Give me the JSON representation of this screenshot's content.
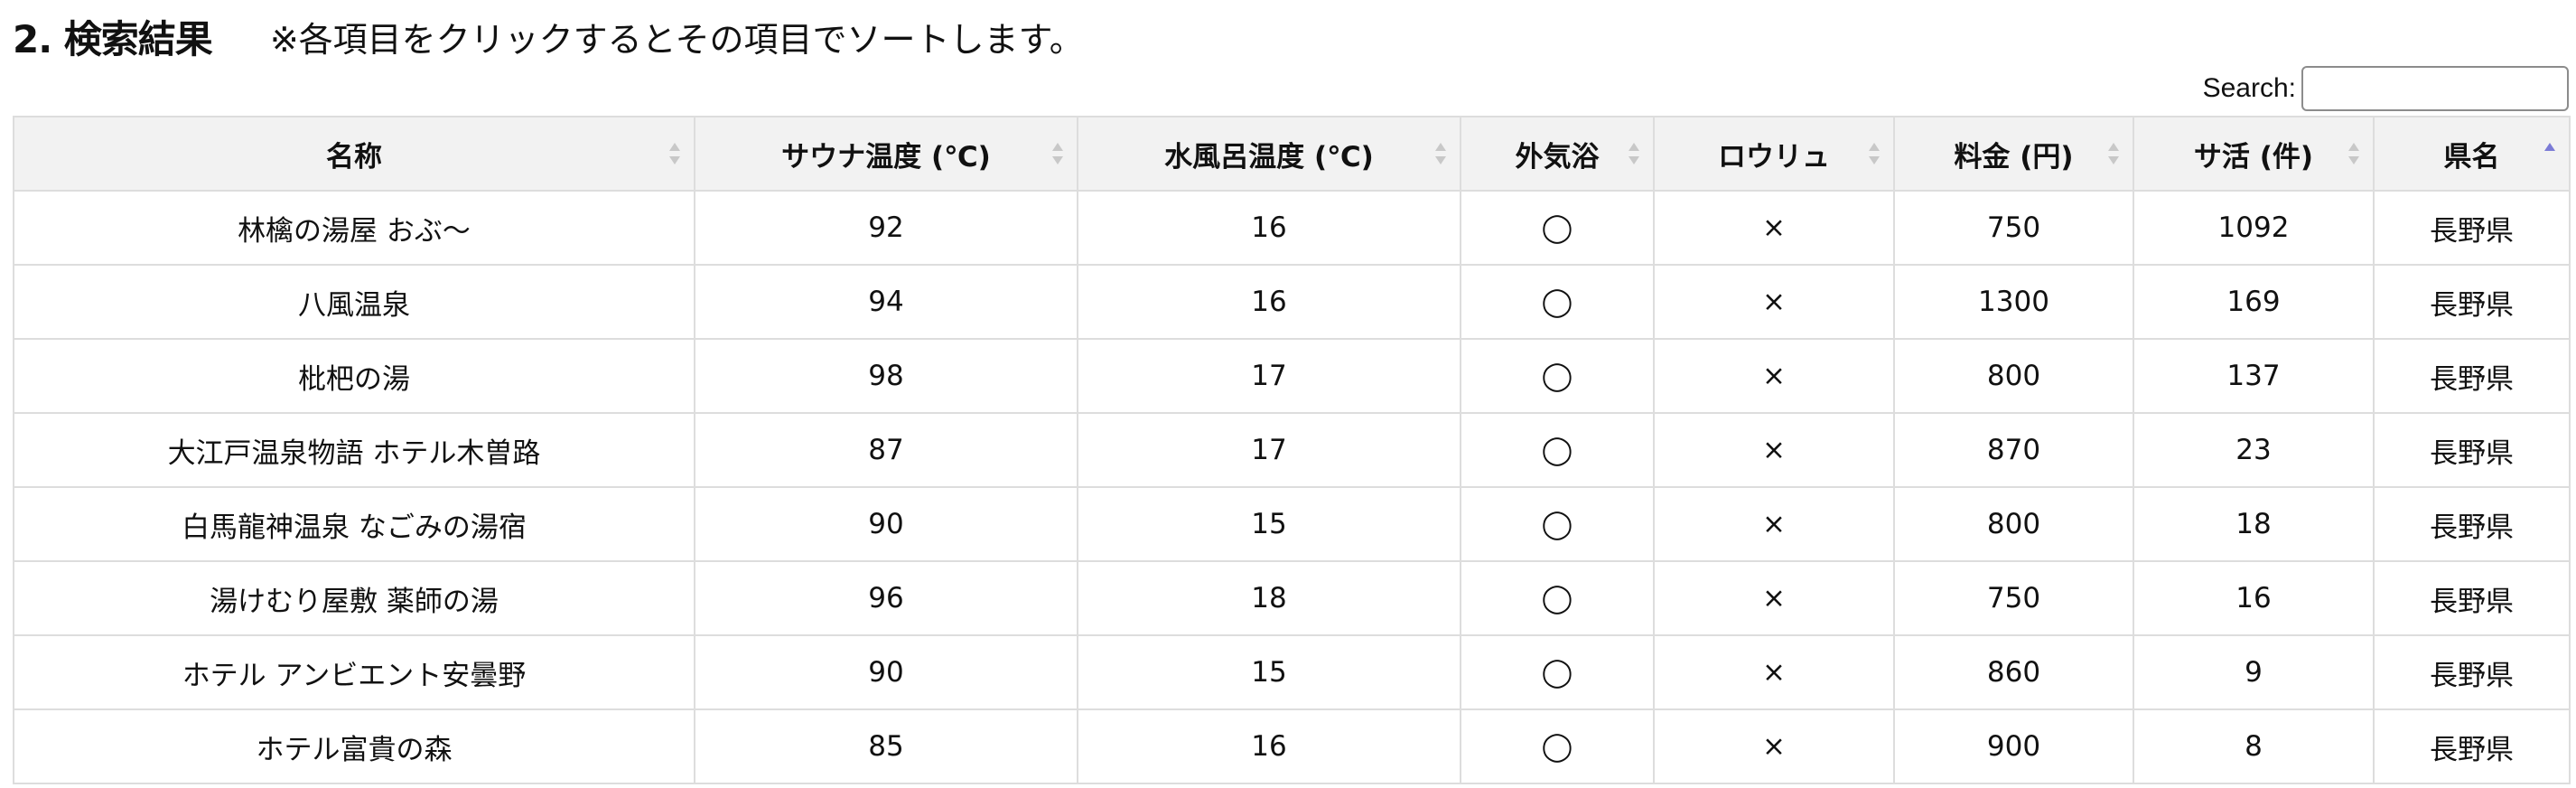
{
  "heading": {
    "title": "2. 検索結果",
    "note": "※各項目をクリックするとその項目でソートします。"
  },
  "search": {
    "label": "Search:",
    "value": ""
  },
  "table": {
    "columns": [
      {
        "key": "name",
        "label": "名称",
        "sort": "none"
      },
      {
        "key": "sauna",
        "label": "サウナ温度 (℃)",
        "sort": "none"
      },
      {
        "key": "water",
        "label": "水風呂温度 (℃)",
        "sort": "none"
      },
      {
        "key": "outdoor",
        "label": "外気浴",
        "sort": "none"
      },
      {
        "key": "loyly",
        "label": "ロウリュ",
        "sort": "none"
      },
      {
        "key": "price",
        "label": "料金 (円)",
        "sort": "none"
      },
      {
        "key": "sakatsu",
        "label": "サ活 (件)",
        "sort": "none"
      },
      {
        "key": "pref",
        "label": "県名",
        "sort": "asc"
      }
    ],
    "rows": [
      [
        "林檎の湯屋 おぶ〜",
        "92",
        "16",
        "◯",
        "×",
        "750",
        "1092",
        "長野県"
      ],
      [
        "八風温泉",
        "94",
        "16",
        "◯",
        "×",
        "1300",
        "169",
        "長野県"
      ],
      [
        "枇杷の湯",
        "98",
        "17",
        "◯",
        "×",
        "800",
        "137",
        "長野県"
      ],
      [
        "大江戸温泉物語 ホテル木曽路",
        "87",
        "17",
        "◯",
        "×",
        "870",
        "23",
        "長野県"
      ],
      [
        "白馬龍神温泉 なごみの湯宿",
        "90",
        "15",
        "◯",
        "×",
        "800",
        "18",
        "長野県"
      ],
      [
        "湯けむり屋敷 薬師の湯",
        "96",
        "18",
        "◯",
        "×",
        "750",
        "16",
        "長野県"
      ],
      [
        "ホテル アンビエント安曇野",
        "90",
        "15",
        "◯",
        "×",
        "860",
        "9",
        "長野県"
      ],
      [
        "ホテル富貴の森",
        "85",
        "16",
        "◯",
        "×",
        "900",
        "8",
        "長野県"
      ]
    ]
  },
  "colors": {
    "header_bg": "#f2f2f2",
    "border": "#dddddd",
    "sort_inactive": "#c8c8c8",
    "sort_active": "#7b7bd6"
  }
}
